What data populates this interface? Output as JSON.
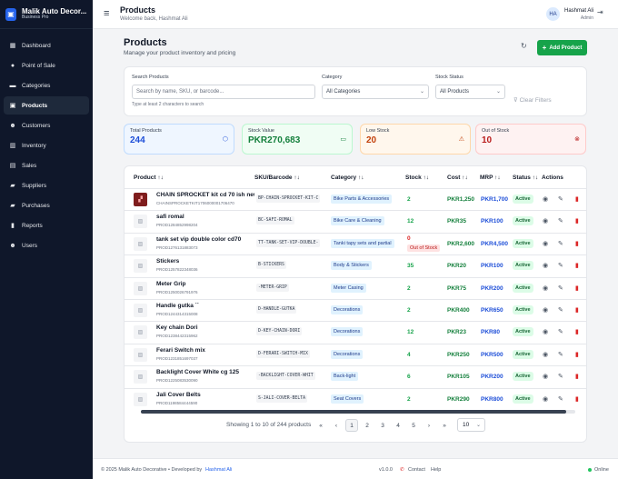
{
  "brand": {
    "name": "Malik Auto Decor...",
    "plan": "Business Pro"
  },
  "sidebar": {
    "items": [
      {
        "label": "Dashboard",
        "icon": "dashboard-icon",
        "glyph": "▦"
      },
      {
        "label": "Point of Sale",
        "icon": "pos-icon",
        "glyph": "●"
      },
      {
        "label": "Categories",
        "icon": "folder-icon",
        "glyph": "▬"
      },
      {
        "label": "Products",
        "icon": "box-icon",
        "glyph": "▣"
      },
      {
        "label": "Customers",
        "icon": "users-icon",
        "glyph": "☻"
      },
      {
        "label": "Inventory",
        "icon": "warehouse-icon",
        "glyph": "▥"
      },
      {
        "label": "Sales",
        "icon": "receipt-icon",
        "glyph": "▤"
      },
      {
        "label": "Suppliers",
        "icon": "truck-icon",
        "glyph": "▰"
      },
      {
        "label": "Purchases",
        "icon": "cart-icon",
        "glyph": "▰"
      },
      {
        "label": "Reports",
        "icon": "chart-icon",
        "glyph": "▮"
      },
      {
        "label": "Users",
        "icon": "user-icon",
        "glyph": "☻"
      }
    ],
    "active_index": 3
  },
  "topbar": {
    "title": "Products",
    "subtitle": "Welcome back, Hashmat Ali",
    "avatar": "HA",
    "user_name": "Hashmat Ali",
    "user_role": "Admin"
  },
  "page": {
    "title": "Products",
    "subtitle": "Manage your product inventory and pricing",
    "add_button": "Add Product"
  },
  "filters": {
    "search_label": "Search Products",
    "search_placeholder": "Search by name, SKU, or barcode...",
    "search_hint": "Type at least 2 characters to search",
    "category_label": "Category",
    "category_value": "All Categories",
    "status_label": "Stock Status",
    "status_value": "All Products",
    "clear_label": "Clear Filters"
  },
  "stats": [
    {
      "label": "Total Products",
      "value": "244",
      "color": "#1d4ed8",
      "bg": "#eff6ff",
      "border": "#bfdbfe",
      "icon": "cube-icon",
      "glyph": "⬡"
    },
    {
      "label": "Stock Value",
      "value": "PKR270,683",
      "color": "#15803d",
      "bg": "#f0fdf4",
      "border": "#bbf7d0",
      "icon": "cash-icon",
      "glyph": "▭"
    },
    {
      "label": "Low Stock",
      "value": "20",
      "color": "#c2410c",
      "bg": "#fff7ed",
      "border": "#fed7aa",
      "icon": "warning-icon",
      "glyph": "⚠"
    },
    {
      "label": "Out of Stock",
      "value": "10",
      "color": "#b91c1c",
      "bg": "#fef2f2",
      "border": "#fecaca",
      "icon": "x-circle-icon",
      "glyph": "⊗"
    }
  ],
  "table": {
    "headers": [
      "Product ↑↓",
      "SKU/Barcode ↑↓",
      "Category ↑↓",
      "Stock ↑↓",
      "Cost ↑↓",
      "MRP ↑↓",
      "Status ↑↓",
      "Actions"
    ],
    "rows": [
      {
        "name": "CHAIN SPROCKET kit cd 70 ish new",
        "code": "CHAINSPROCKETKIT1706000001706470",
        "sku": "BP-CHAIN-SPROCKET-KIT-C",
        "category": "Bike Parts & Accessories",
        "stock": "2",
        "oos": "",
        "cost": "PKR1,250",
        "mrp": "PKR1,700",
        "status": "Active",
        "has_image": true
      },
      {
        "name": "safi romal",
        "code": "PROD1284852998204",
        "sku": "BC-SAFI-ROMAL",
        "category": "Bike Care & Cleaning",
        "stock": "12",
        "oos": "",
        "cost": "PKR35",
        "mrp": "PKR100",
        "status": "Active",
        "has_image": false
      },
      {
        "name": "tank set vip double color cd70",
        "code": "PROD1276131883073",
        "sku": "TT-TANK-SET-VIP-DOUBLE-",
        "category": "Tanki tapy sets and partial",
        "stock": "0",
        "oos": "Out of Stock",
        "cost": "PKR2,600",
        "mrp": "PKR4,500",
        "status": "Active",
        "has_image": false
      },
      {
        "name": "Stickers",
        "code": "PROD1257822348036",
        "sku": "B-STICKERS",
        "category": "Body & Stickers",
        "stock": "35",
        "oos": "",
        "cost": "PKR20",
        "mrp": "PKR100",
        "status": "Active",
        "has_image": false
      },
      {
        "name": "Meter Grip",
        "code": "PROD1250026791976",
        "sku": "-METER-GRIP",
        "category": "Meter Casing",
        "stock": "2",
        "oos": "",
        "cost": "PKR75",
        "mrp": "PKR200",
        "status": "Active",
        "has_image": false
      },
      {
        "name": "Handle gutka ``",
        "code": "PROD1244314315008",
        "sku": "D-HANDLE-GUTKA",
        "category": "Decorations",
        "stock": "2",
        "oos": "",
        "cost": "PKR400",
        "mrp": "PKR650",
        "status": "Active",
        "has_image": false
      },
      {
        "name": "Key chain Dori",
        "code": "PROD1238442315962",
        "sku": "D-KEY-CHAIN-DORI",
        "category": "Decorations",
        "stock": "12",
        "oos": "",
        "cost": "PKR23",
        "mrp": "PKR80",
        "status": "Active",
        "has_image": false
      },
      {
        "name": "Ferari Switch mix",
        "code": "PROD1231851697037",
        "sku": "D-FERARI-SWITCH-MIX",
        "category": "Decorations",
        "stock": "4",
        "oos": "",
        "cost": "PKR250",
        "mrp": "PKR500",
        "status": "Active",
        "has_image": false
      },
      {
        "name": "Backlight Cover White cg 125",
        "code": "PROD1225083530090",
        "sku": "-BACKLIGHT-COVER-WHIT",
        "category": "Back-light",
        "stock": "6",
        "oos": "",
        "cost": "PKR105",
        "mrp": "PKR200",
        "status": "Active",
        "has_image": false
      },
      {
        "name": "Jali Cover Belts",
        "code": "PROD1198584444590",
        "sku": "S-JALI-COVER-BELTA",
        "category": "Seat Covers",
        "stock": "2",
        "oos": "",
        "cost": "PKR290",
        "mrp": "PKR800",
        "status": "Active",
        "has_image": false
      }
    ]
  },
  "pagination": {
    "info": "Showing 1 to 10 of 244 products",
    "pages": [
      "1",
      "2",
      "3",
      "4",
      "5"
    ],
    "first": "«",
    "prev": "‹",
    "next": "›",
    "last": "»",
    "per_page": "10"
  },
  "footer": {
    "copyright": "© 2025 Malik Auto Decorative • Developed by",
    "developer": "Hashmat Ali",
    "version": "v1.0.0",
    "contact": "Contact",
    "help": "Help",
    "status": "Online"
  }
}
